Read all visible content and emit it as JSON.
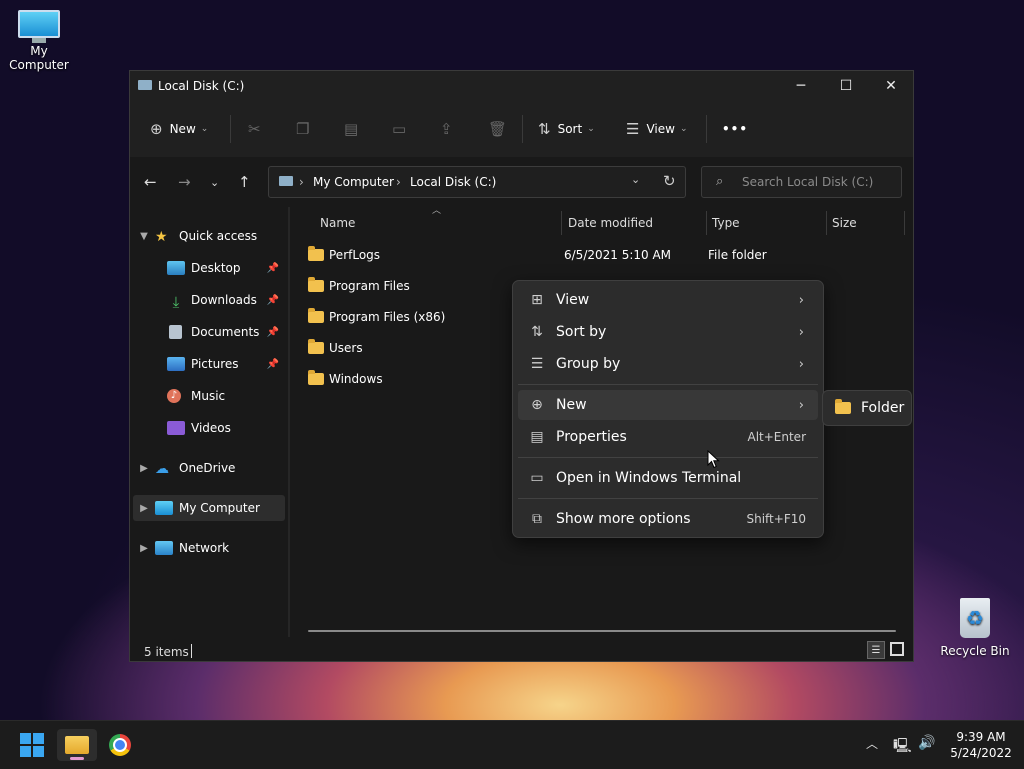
{
  "desktop": {
    "my_computer_label": "My Computer",
    "recycle_bin_label": "Recycle Bin"
  },
  "window": {
    "title": "Local Disk (C:)",
    "controls": {
      "minimize": "─",
      "maximize": "☐",
      "close": "✕"
    }
  },
  "toolbar": {
    "new_label": "New",
    "sort_label": "Sort",
    "view_label": "View",
    "more_label": "•••"
  },
  "address": {
    "crumbs": [
      "My Computer",
      "Local Disk (C:)"
    ],
    "search_placeholder": "Search Local Disk (C:)"
  },
  "sidebar": {
    "items": [
      {
        "label": "Quick access"
      },
      {
        "label": "Desktop"
      },
      {
        "label": "Downloads"
      },
      {
        "label": "Documents"
      },
      {
        "label": "Pictures"
      },
      {
        "label": "Music"
      },
      {
        "label": "Videos"
      },
      {
        "label": "OneDrive"
      },
      {
        "label": "My Computer"
      },
      {
        "label": "Network"
      }
    ]
  },
  "columns": {
    "name": "Name",
    "date": "Date modified",
    "type": "Type",
    "size": "Size"
  },
  "files": [
    {
      "name": "PerfLogs",
      "date": "6/5/2021 5:10 AM",
      "type": "File folder"
    },
    {
      "name": "Program Files",
      "date": "",
      "type": ""
    },
    {
      "name": "Program Files (x86)",
      "date": "",
      "type": ""
    },
    {
      "name": "Users",
      "date": "",
      "type": ""
    },
    {
      "name": "Windows",
      "date": "",
      "type": ""
    }
  ],
  "status": {
    "item_count": "5 items"
  },
  "context_menu": {
    "items": [
      {
        "label": "View"
      },
      {
        "label": "Sort by"
      },
      {
        "label": "Group by"
      },
      {
        "label": "New"
      },
      {
        "label": "Properties",
        "shortcut": "Alt+Enter"
      },
      {
        "label": "Open in Windows Terminal"
      },
      {
        "label": "Show more options",
        "shortcut": "Shift+F10"
      }
    ],
    "submenu": {
      "label": "Folder"
    }
  },
  "taskbar": {
    "time": "9:39 AM",
    "date": "5/24/2022"
  },
  "colors": {
    "accent": "#4cc2ff",
    "folder": "#f2c14e"
  }
}
